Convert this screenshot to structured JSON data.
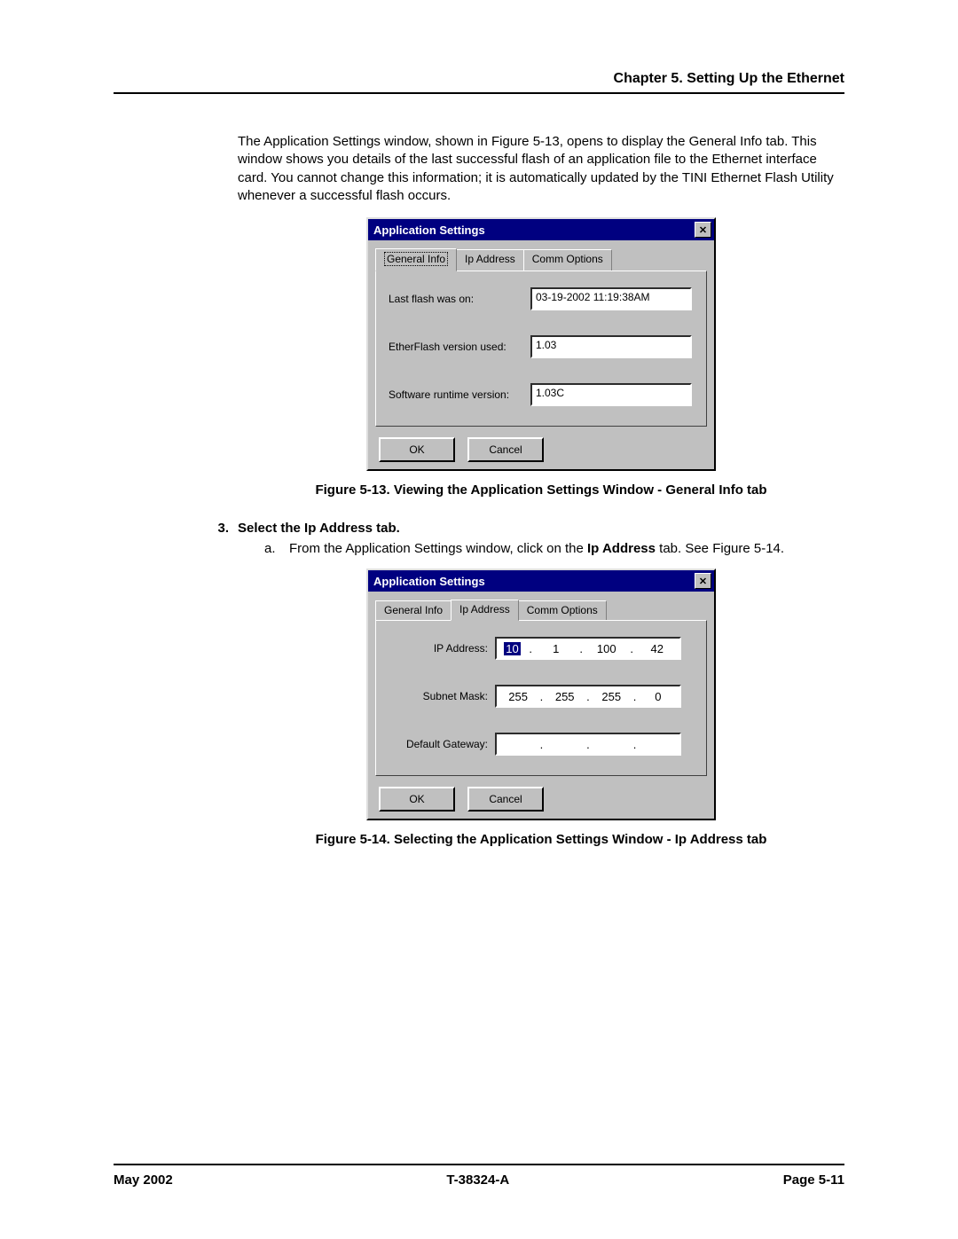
{
  "header": {
    "chapter": "Chapter 5. Setting Up the Ethernet"
  },
  "paragraph1": "The Application Settings window, shown in Figure 5-13, opens to display the General Info tab. This window shows you details of the last successful flash of an application file to the Ethernet interface card. You cannot change this information; it is automatically updated by the TINI Ethernet Flash Utility whenever a successful flash occurs.",
  "dialog1": {
    "title": "Application Settings",
    "tabs": {
      "general": "General Info",
      "ip": "Ip Address",
      "comm": "Comm Options"
    },
    "fields": {
      "last_flash_label": "Last flash was on:",
      "last_flash_value": "03-19-2002 11:19:38AM",
      "version_label": "EtherFlash version used:",
      "version_value": "1.03",
      "runtime_label": "Software runtime version:",
      "runtime_value": "1.03C"
    },
    "buttons": {
      "ok": "OK",
      "cancel": "Cancel"
    }
  },
  "caption1": "Figure 5-13. Viewing the Application Settings Window - General Info tab",
  "step3": {
    "num": "3.",
    "title": "Select the Ip Address tab.",
    "sub_a_letter": "a.",
    "sub_a_pre": "From the Application Settings window, click on the ",
    "sub_a_bold": "Ip Address",
    "sub_a_post": " tab. See Figure 5-14."
  },
  "dialog2": {
    "title": "Application Settings",
    "tabs": {
      "general": "General Info",
      "ip": "Ip Address",
      "comm": "Comm Options"
    },
    "fields": {
      "ip_label": "IP Address:",
      "ip": {
        "o1": "10",
        "o2": "1",
        "o3": "100",
        "o4": "42"
      },
      "mask_label": "Subnet Mask:",
      "mask": {
        "o1": "255",
        "o2": "255",
        "o3": "255",
        "o4": "0"
      },
      "gw_label": "Default Gateway:",
      "gw": {
        "o1": "",
        "o2": "",
        "o3": "",
        "o4": ""
      }
    },
    "buttons": {
      "ok": "OK",
      "cancel": "Cancel"
    }
  },
  "caption2": "Figure 5-14. Selecting the Application Settings Window - Ip Address tab",
  "footer": {
    "left": "May 2002",
    "center": "T-38324-A",
    "right": "Page 5-11"
  },
  "dot": "."
}
